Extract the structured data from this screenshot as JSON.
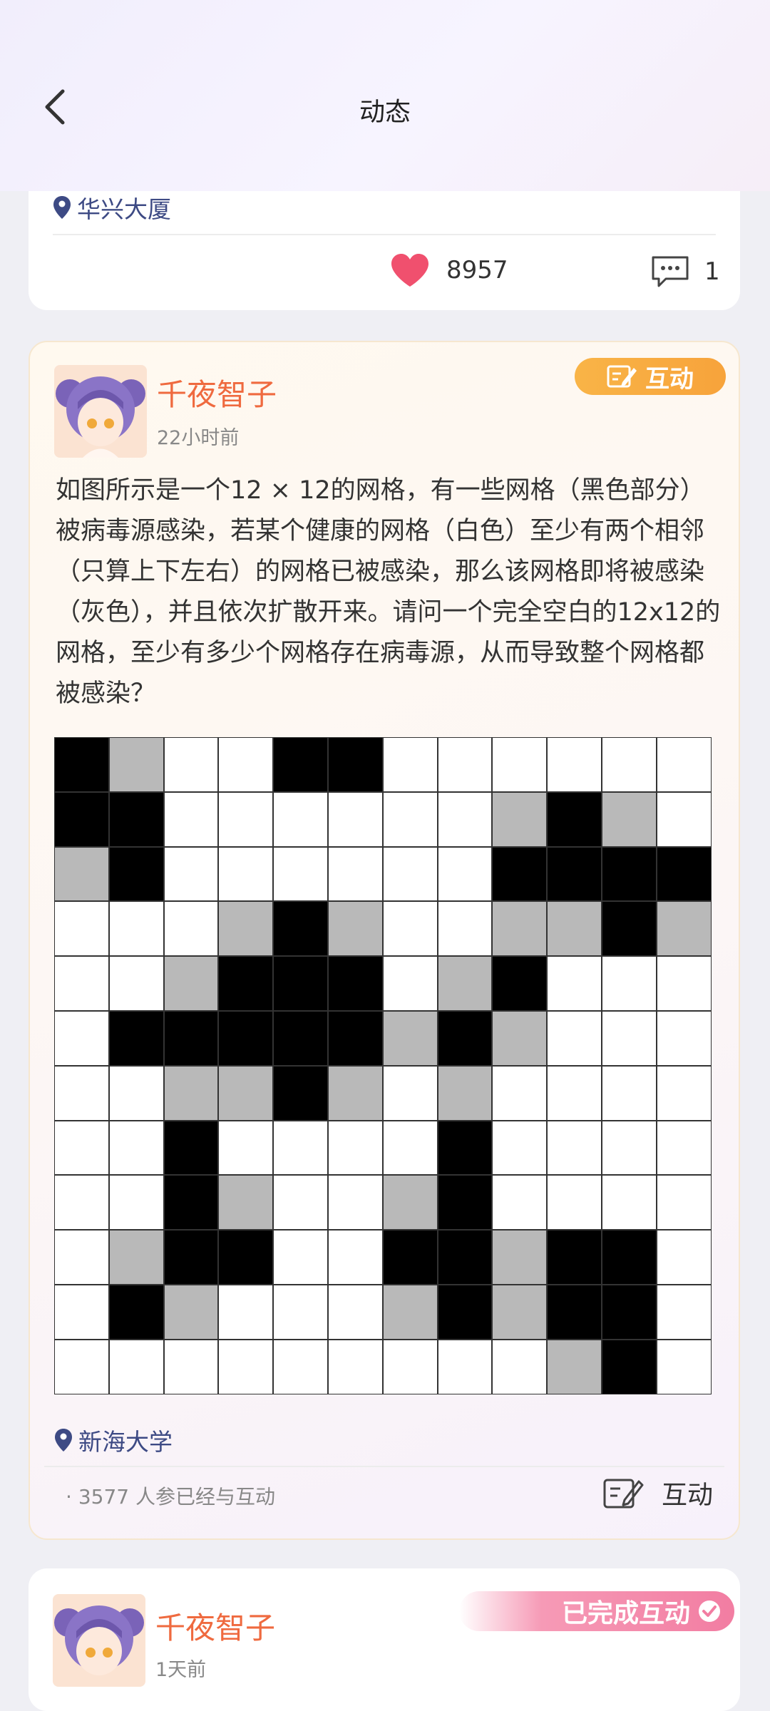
{
  "header": {
    "title": "动态"
  },
  "post1": {
    "location": "华兴大厦",
    "likes": "8957",
    "comments": "1"
  },
  "post2": {
    "username": "千夜智子",
    "time": "22小时前",
    "badge": "互动",
    "text": "如图所示是一个12 × 12的网格，有一些网格（黑色部分）被病毒源感染，若某个健康的网格（白色）至少有两个相邻（只算上下左右）的网格已被感染，那么该网格即将被感染（灰色），并且依次扩散开来。请问一个完全空白的12x12的网格，至少有多少个网格存在病毒源，从而导致整个网格都被感染？",
    "grid": [
      "bgwwbbwwwwww",
      "bbwwwwwwgbgw",
      "gbwwwwwwbbbb",
      "wwwgbgwwggbg",
      "wwgbbbwgbwww",
      "wbbbbbgbgwww",
      "wwggbgwgwwww",
      "wwbwwwwbwwww",
      "wwbgwwgbwwww",
      "wgbbwwbbgbbw",
      "wbgwwwgbgbbw",
      "wwwwwwwwwgbw"
    ],
    "location": "新海大学",
    "participants_count": "3577",
    "participants_text": "人参已经与互动",
    "interact_label": "互动"
  },
  "post3": {
    "username": "千夜智子",
    "time": "1天前",
    "badge": "已完成互动"
  },
  "colors": {
    "accent_orange": "#ef6a3f",
    "badge_orange": "#f9b447",
    "heart": "#f0506e",
    "location_blue": "#3d4a84"
  }
}
